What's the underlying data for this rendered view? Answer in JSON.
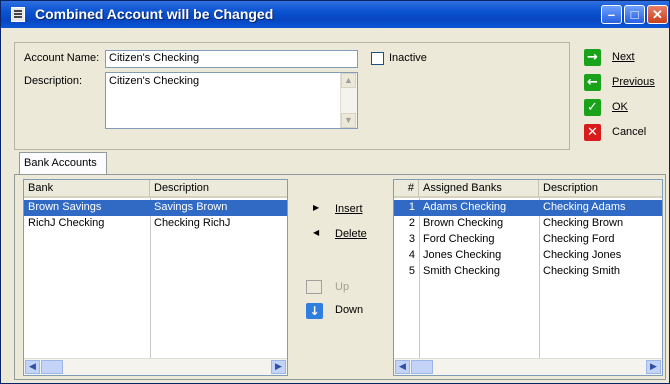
{
  "window": {
    "title": "Combined Account will be Changed"
  },
  "form": {
    "account_name_label": "Account Name:",
    "account_name_value": "Citizen's Checking",
    "inactive_label": "Inactive",
    "description_label": "Description:",
    "description_value": "Citizen's Checking"
  },
  "actions": {
    "next": "Next",
    "previous": "Previous",
    "ok": "OK",
    "cancel": "Cancel"
  },
  "tabs": {
    "bank_accounts": "Bank Accounts"
  },
  "left_grid": {
    "headers": {
      "bank": "Bank",
      "description": "Description"
    },
    "rows": [
      {
        "bank": "Brown Savings",
        "description": "Savings Brown"
      },
      {
        "bank": "RichJ Checking",
        "description": "Checking RichJ"
      }
    ]
  },
  "middle": {
    "insert": "Insert",
    "delete": "Delete",
    "up": "Up",
    "down": "Down"
  },
  "right_grid": {
    "headers": {
      "num": "#",
      "assigned": "Assigned Banks",
      "description": "Description"
    },
    "rows": [
      {
        "num": "1",
        "assigned": "Adams Checking",
        "description": "Checking Adams"
      },
      {
        "num": "2",
        "assigned": "Brown Checking",
        "description": "Checking Brown"
      },
      {
        "num": "3",
        "assigned": "Ford Checking",
        "description": "Checking Ford"
      },
      {
        "num": "4",
        "assigned": "Jones Checking",
        "description": "Checking Jones"
      },
      {
        "num": "5",
        "assigned": "Smith Checking",
        "description": "Checking Smith"
      }
    ]
  }
}
